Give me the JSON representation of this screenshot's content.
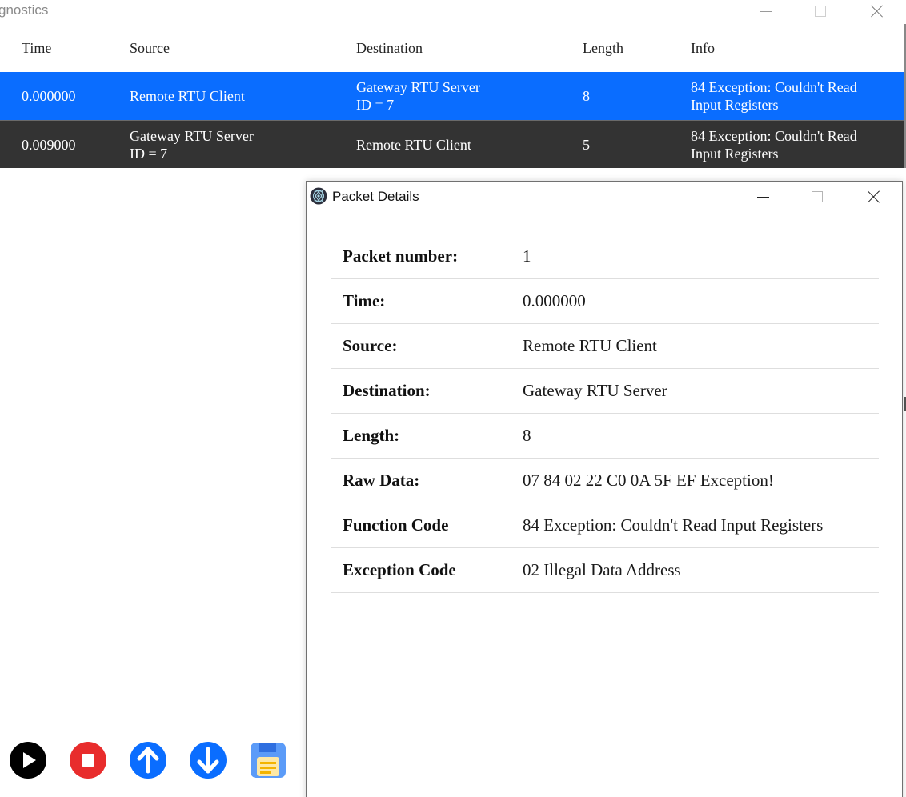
{
  "main_window": {
    "title": "gnostics"
  },
  "table": {
    "headers": [
      "Time",
      "Source",
      "Destination",
      "Length",
      "Info"
    ],
    "rows": [
      {
        "time": "0.000000",
        "source": [
          "Remote RTU Client"
        ],
        "destination": [
          "Gateway RTU Server",
          "ID = 7"
        ],
        "length": "8",
        "info": [
          "84 Exception: Couldn't Read",
          "Input Registers"
        ],
        "selected": true
      },
      {
        "time": "0.009000",
        "source": [
          "Gateway RTU Server",
          "ID = 7"
        ],
        "destination": [
          "Remote RTU Client"
        ],
        "length": "5",
        "info": [
          "84 Exception: Couldn't Read",
          "Input Registers"
        ],
        "selected": false
      }
    ]
  },
  "toolbar": {
    "buttons": [
      {
        "name": "play",
        "icon": "play-icon",
        "color": "#000000"
      },
      {
        "name": "stop",
        "icon": "stop-icon",
        "color": "#e82c2c"
      },
      {
        "name": "upload",
        "icon": "arrow-up-icon",
        "color": "#0a6dff"
      },
      {
        "name": "download",
        "icon": "arrow-down-icon",
        "color": "#0a6dff"
      },
      {
        "name": "save",
        "icon": "save-log-icon",
        "color": "#2f7df6"
      }
    ]
  },
  "dialog": {
    "title": "Packet Details",
    "fields": [
      {
        "label": "Packet number:",
        "value": "1"
      },
      {
        "label": "Time:",
        "value": "0.000000"
      },
      {
        "label": "Source:",
        "value": "Remote RTU Client"
      },
      {
        "label": "Destination:",
        "value": "Gateway RTU Server"
      },
      {
        "label": "Length:",
        "value": "8"
      },
      {
        "label": "Raw Data:",
        "value": "07 84 02 22 C0 0A 5F EF Exception!"
      },
      {
        "label": "Function Code",
        "value": "84 Exception: Couldn't Read Input Registers"
      },
      {
        "label": "Exception Code",
        "value": "02 Illegal Data Address"
      }
    ]
  },
  "colors": {
    "selected_row": "#0a6dff",
    "normal_row": "#333333"
  }
}
